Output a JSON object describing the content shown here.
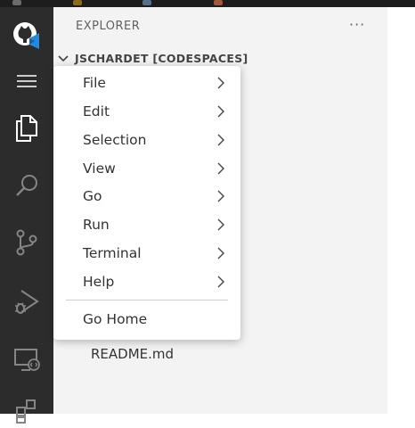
{
  "explorer": {
    "title": "EXPLORER",
    "more_label": "···",
    "folder_name": "JSCHARDET [CODESPACES]",
    "files": [
      "README.md"
    ]
  },
  "menu": {
    "items": [
      {
        "label": "File",
        "has_submenu": true
      },
      {
        "label": "Edit",
        "has_submenu": true
      },
      {
        "label": "Selection",
        "has_submenu": true
      },
      {
        "label": "View",
        "has_submenu": true
      },
      {
        "label": "Go",
        "has_submenu": true
      },
      {
        "label": "Run",
        "has_submenu": true
      },
      {
        "label": "Terminal",
        "has_submenu": true
      },
      {
        "label": "Help",
        "has_submenu": true
      }
    ],
    "go_home_label": "Go Home"
  },
  "activity_bar": {
    "icons": [
      "github-codespaces-icon",
      "menu-icon",
      "files-icon",
      "search-icon",
      "source-control-icon",
      "run-debug-icon",
      "remote-explorer-icon",
      "extensions-icon"
    ]
  },
  "colors": {
    "activity_bar_bg": "#2c2c2c",
    "sidebar_bg": "#f3f3f3",
    "menu_bg": "#ffffff",
    "vscode_blue": "#2489db"
  }
}
